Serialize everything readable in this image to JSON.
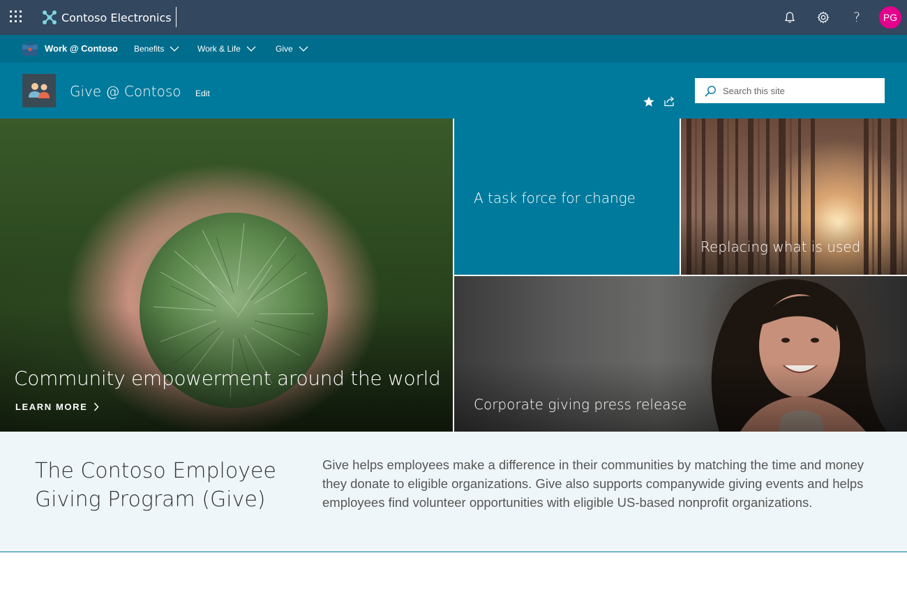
{
  "suite_bar": {
    "app_name": "Contoso Electronics",
    "avatar_initials": "PG",
    "icons": [
      "app-launcher-icon",
      "bell-icon",
      "gear-icon",
      "help-icon"
    ],
    "help_label": "?",
    "avatar_color": "#e3008c",
    "background": "#33475f"
  },
  "hub_nav": {
    "title": "Work @ Contoso",
    "items": [
      {
        "label": "Benefits"
      },
      {
        "label": "Work & Life"
      },
      {
        "label": "Give"
      }
    ],
    "background": "#006d8c"
  },
  "site_header": {
    "title": "Give @ Contoso",
    "edit_label": "Edit",
    "search_placeholder": "Search this site",
    "background": "#007a9c"
  },
  "hero": {
    "main": {
      "title": "Community empowerment around the world",
      "cta": "LEARN MORE"
    },
    "tiles": [
      {
        "title": "A task force for change"
      },
      {
        "title": "Replacing what is used"
      },
      {
        "title": "Corporate giving press release"
      }
    ]
  },
  "intro": {
    "title": "The Contoso Employee Giving Program (Give)",
    "body": "Give helps employees make a difference in their communities by matching the time and money they donate to eligible organizations. Give also supports companywide giving events and helps employees find volunteer opportunities with eligible US-based nonprofit organizations."
  }
}
